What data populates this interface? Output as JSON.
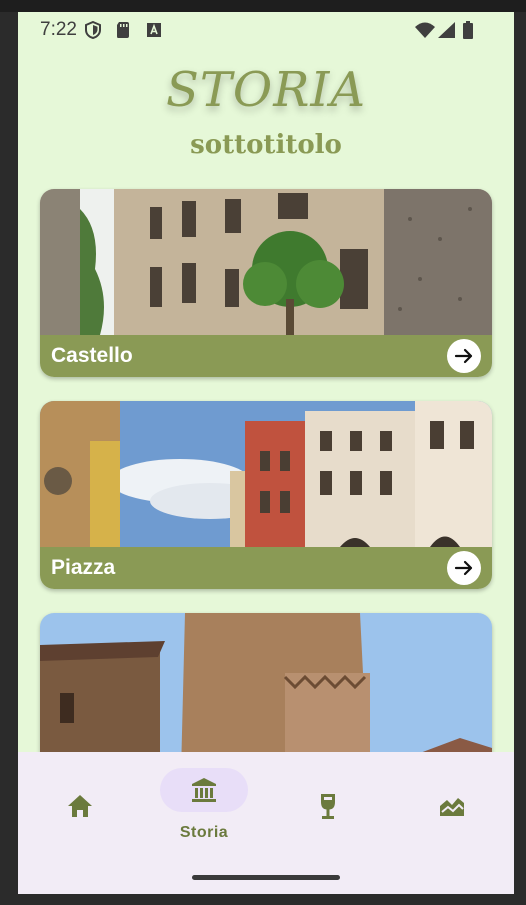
{
  "status_bar": {
    "time": "7:22",
    "icons": [
      "shield-icon",
      "sim-card-icon",
      "text-a-icon",
      "wifi-icon",
      "cell-signal-icon",
      "battery-icon"
    ]
  },
  "header": {
    "title": "STORIA",
    "subtitle": "sottotitolo"
  },
  "cards": [
    {
      "label": "Castello",
      "image": "castle-street-photo",
      "action_icon": "arrow-right-icon"
    },
    {
      "label": "Piazza",
      "image": "piazza-buildings-photo",
      "action_icon": "arrow-right-icon"
    },
    {
      "label": "",
      "image": "tower-photo"
    }
  ],
  "bottom_nav": {
    "items": [
      {
        "icon": "home-icon",
        "label": ""
      },
      {
        "icon": "museum-icon",
        "label": "Storia",
        "selected": true
      },
      {
        "icon": "wine-glass-icon",
        "label": ""
      },
      {
        "icon": "landscape-icon",
        "label": ""
      }
    ]
  },
  "colors": {
    "background": "#e6f8d8",
    "accent": "#8a9a55",
    "nav_background": "#f2ecf6",
    "nav_selected_pill": "#e8def8"
  }
}
